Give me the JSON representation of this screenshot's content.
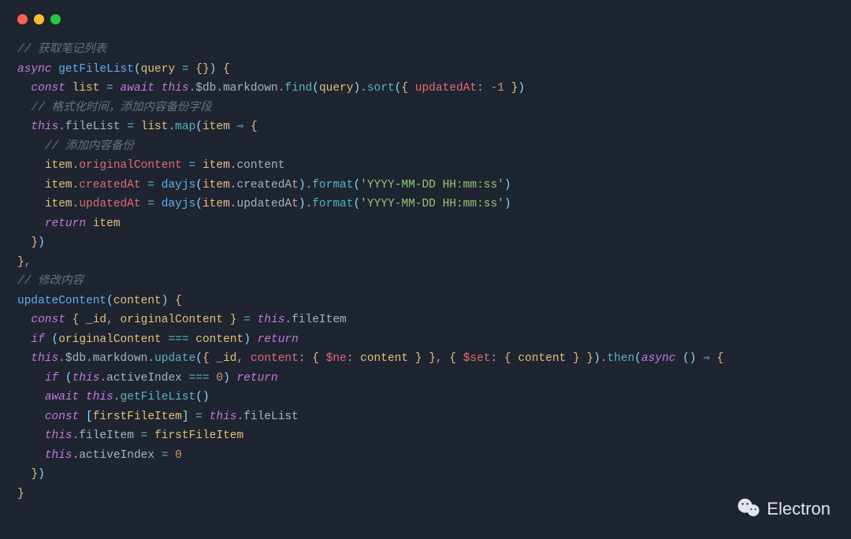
{
  "theme": {
    "background": "#1e2430",
    "comment": "#6b7280",
    "keyword": "#c678dd",
    "function_def": "#61afef",
    "function_call": "#56b6c2",
    "variable": "#e5c07b",
    "property": "#abb2bf",
    "red_property": "#e06c75",
    "string": "#98c379",
    "number": "#d19a66"
  },
  "traffic_lights": [
    "#ff5f56",
    "#ffbd2e",
    "#27c93f"
  ],
  "watermark": {
    "label": "Electron",
    "icon": "wechat-icon"
  },
  "code": {
    "comments": {
      "c1": "// 获取笔记列表",
      "c2": "// 格式化时间，添加内容备份字段",
      "c3": "// 添加内容备份",
      "c4": "// 修改内容"
    },
    "keywords": {
      "async": "async",
      "const": "const",
      "await": "await",
      "this": "this",
      "return": "return",
      "if": "if"
    },
    "funcs": {
      "getFileList": "getFileList",
      "updateContent": "updateContent",
      "find": "find",
      "sort": "sort",
      "map": "map",
      "format": "format",
      "update": "update",
      "then": "then",
      "dayjs": "dayjs"
    },
    "vars": {
      "query": "query",
      "list": "list",
      "item": "item",
      "content": "content",
      "_id": "_id",
      "originalContent": "originalContent",
      "firstFileItem": "firstFileItem"
    },
    "props": {
      "db": "$db",
      "markdown": "markdown",
      "fileList": "fileList",
      "fileItem": "fileItem",
      "activeIndex": "activeIndex",
      "originalContent": "originalContent",
      "content": "content",
      "createdAt": "createdAt",
      "updatedAt": "updatedAt",
      "ne": "$ne",
      "set": "$set"
    },
    "strings": {
      "fmt": "'YYYY-MM-DD HH:mm:ss'"
    },
    "numbers": {
      "neg1": "-1",
      "zero": "0"
    },
    "ops": {
      "eq": "=",
      "eqeqeq": "===",
      "arrow": "⇒"
    }
  }
}
